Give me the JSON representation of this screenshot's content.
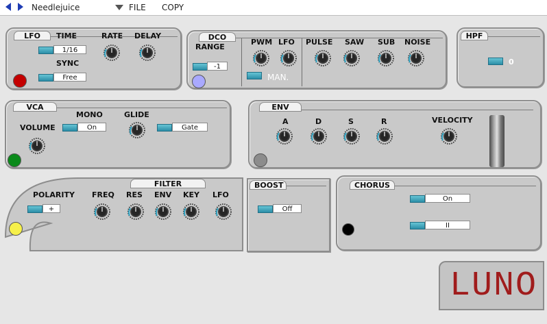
{
  "window": {
    "title": "Needlejuice",
    "menu": {
      "file": "FILE",
      "copy": "COPY"
    }
  },
  "lfo": {
    "title": "LFO",
    "time_label": "TIME",
    "time_value": "1/16",
    "sync_label": "SYNC",
    "sync_value": "Free",
    "rate_label": "RATE",
    "delay_label": "DELAY",
    "led_color": "#c40000"
  },
  "dco": {
    "title": "DCO",
    "range_label": "RANGE",
    "range_value": "-1",
    "pwm_label": "PWM",
    "lfo_label": "LFO",
    "man_label": "MAN.",
    "pulse_label": "PULSE",
    "saw_label": "SAW",
    "sub_label": "SUB",
    "noise_label": "NOISE",
    "led_color": "#a9a9ff"
  },
  "hpf": {
    "title": "HPF",
    "value": "0"
  },
  "vca": {
    "title": "VCA",
    "mono_label": "MONO",
    "mono_value": "On",
    "glide_label": "GLIDE",
    "gate_value": "Gate",
    "volume_label": "VOLUME",
    "led_color": "#0a8a1a"
  },
  "env": {
    "title": "ENV",
    "a_label": "A",
    "d_label": "D",
    "s_label": "S",
    "r_label": "R",
    "velocity_label": "VELOCITY",
    "led_color": "#8c8c8c"
  },
  "filter": {
    "title": "FILTER",
    "polarity_label": "POLARITY",
    "polarity_value": "+",
    "freq_label": "FREQ",
    "res_label": "RES",
    "env_label": "ENV",
    "key_label": "KEY",
    "lfo_label": "LFO",
    "led_color": "#f6f04a"
  },
  "boost": {
    "title": "BOOST",
    "value": "Off"
  },
  "chorus": {
    "title": "CHORUS",
    "value1": "On",
    "value2": "II",
    "led_color": "#000000"
  },
  "logo": {
    "text": "LUNO"
  }
}
